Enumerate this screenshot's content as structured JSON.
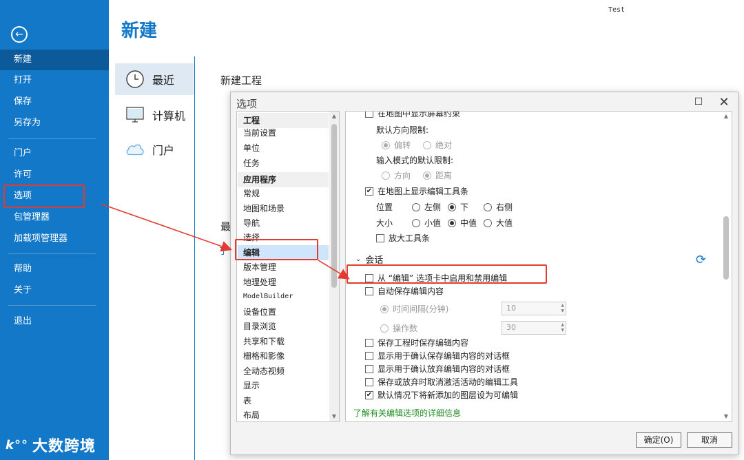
{
  "backstage": {
    "title": "新建",
    "test_label": "Test",
    "nav": {
      "items": [
        {
          "label": "新建",
          "active": true
        },
        {
          "label": "打开"
        },
        {
          "label": "保存"
        },
        {
          "label": "另存为"
        },
        {
          "label": "门户"
        },
        {
          "label": "许可"
        },
        {
          "label": "选项"
        },
        {
          "label": "包管理器"
        },
        {
          "label": "加载项管理器"
        },
        {
          "label": "帮助"
        },
        {
          "label": "关于"
        },
        {
          "label": "退出"
        }
      ]
    },
    "locations": [
      {
        "label": "最近",
        "icon": "clock-icon",
        "active": true
      },
      {
        "label": "计算机",
        "icon": "computer-icon"
      },
      {
        "label": "门户",
        "icon": "cloud-icon"
      }
    ],
    "new_project_label": "新建工程",
    "recent_label_partial": "最",
    "learn_link_partial": "了"
  },
  "dialog": {
    "title": "选项",
    "categories": {
      "groups": [
        {
          "header": "工程",
          "items": [
            "当前设置",
            "单位",
            "任务"
          ]
        },
        {
          "header": "应用程序",
          "items": [
            "常规",
            "地图和场景",
            "导航",
            "选择",
            "编辑",
            "版本管理",
            "地理处理",
            "ModelBuilder",
            "设备位置",
            "目录浏览",
            "共享和下载",
            "栅格和影像",
            "全动态视频",
            "显示",
            "表",
            "布局"
          ]
        }
      ],
      "selected": "编辑"
    },
    "panel": {
      "top_partial": "在地图中显示屏幕约束",
      "default_direction_label": "默认方向限制:",
      "direction_options": [
        "偏转",
        "绝对"
      ],
      "input_mode_label": "输入模式的默认限制:",
      "input_mode_options": [
        "方向",
        "距离"
      ],
      "show_toolbar_label": "在地图上显示编辑工具条",
      "position_label": "位置",
      "position_options": [
        "左侧",
        "下",
        "右侧"
      ],
      "size_label": "大小",
      "size_options": [
        "小值",
        "中值",
        "大值"
      ],
      "enlarge_toolbar_label": "放大工具条",
      "session_section": "会话",
      "enable_disable_label": "从 “编辑” 选项卡中启用和禁用编辑",
      "autosave_label": "自动保存编辑内容",
      "time_interval_label": "时间间隔(分钟)",
      "time_interval_value": "10",
      "operations_label": "操作数",
      "operations_value": "30",
      "save_on_project_save_label": "保存工程时保存编辑内容",
      "confirm_save_label": "显示用于确认保存编辑内容的对话框",
      "confirm_discard_label": "显示用于确认放弃编辑内容的对话框",
      "deactivate_tool_label": "保存或放弃时取消激活活动的编辑工具",
      "new_layers_editable_label": "默认情况下将新添加的图层设为可编辑"
    },
    "detail_link": "了解有关编辑选项的详细信息",
    "ok_label": "确定(O)",
    "cancel_label": "取消"
  },
  "watermark": "大数跨境",
  "colors": {
    "brand": "#1378c8",
    "highlight": "#e23b2f",
    "link_green": "#218c21"
  }
}
